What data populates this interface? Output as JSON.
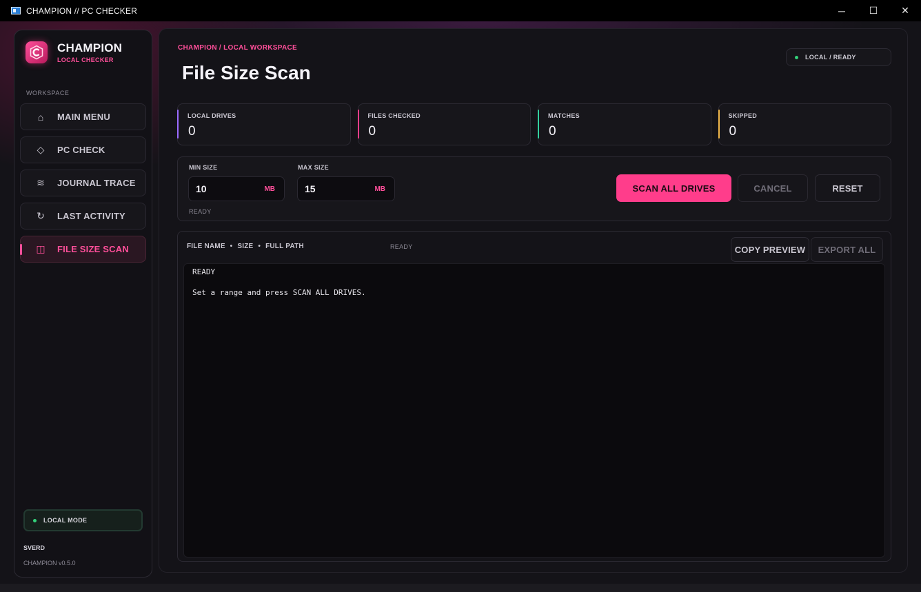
{
  "window": {
    "title": "CHAMPION // PC CHECKER",
    "controls": {
      "minimize": "─",
      "maximize": "☐",
      "close": "✕"
    }
  },
  "sidebar": {
    "brand_name": "CHAMPION",
    "brand_sub": "LOCAL CHECKER",
    "section_label": "WORKSPACE",
    "items": [
      {
        "label": "MAIN MENU",
        "icon": "⌂",
        "icon_name": "home-icon"
      },
      {
        "label": "PC CHECK",
        "icon": "◇",
        "icon_name": "diamond-icon"
      },
      {
        "label": "JOURNAL TRACE",
        "icon": "≋",
        "icon_name": "waves-icon"
      },
      {
        "label": "LAST ACTIVITY",
        "icon": "↻",
        "icon_name": "refresh-icon"
      },
      {
        "label": "FILE SIZE SCAN",
        "icon": "◫",
        "icon_name": "columns-icon",
        "active": true
      }
    ],
    "local_mode": "LOCAL MODE",
    "user": "SVERD",
    "version": "CHAMPION v0.5.0"
  },
  "main": {
    "breadcrumb": "CHAMPION / LOCAL WORKSPACE",
    "title": "File Size Scan",
    "status_pill": "LOCAL / READY",
    "stats": [
      {
        "label": "LOCAL DRIVES",
        "value": "0",
        "color": "#9b6bff"
      },
      {
        "label": "FILES CHECKED",
        "value": "0",
        "color": "#ff3d8b"
      },
      {
        "label": "MATCHES",
        "value": "0",
        "color": "#33d1a0"
      },
      {
        "label": "SKIPPED",
        "value": "0",
        "color": "#f2b84b"
      }
    ],
    "controls": {
      "min_label": "MIN SIZE",
      "min_value": "10",
      "min_unit": "MB",
      "max_label": "MAX SIZE",
      "max_value": "15",
      "max_unit": "MB",
      "status": "READY",
      "scan_button": "SCAN ALL DRIVES",
      "cancel_button": "CANCEL",
      "reset_button": "RESET"
    },
    "results": {
      "col_file_name": "FILE NAME",
      "col_size": "SIZE",
      "col_full_path": "FULL PATH",
      "separator": "•",
      "status": "READY",
      "copy_button": "COPY PREVIEW",
      "export_button": "EXPORT ALL",
      "console_line1": "READY",
      "console_line2": "Set a range and press SCAN ALL DRIVES."
    }
  },
  "colors": {
    "accent": "#ff3d8b",
    "ok": "#33d17a",
    "background": "#141318"
  }
}
